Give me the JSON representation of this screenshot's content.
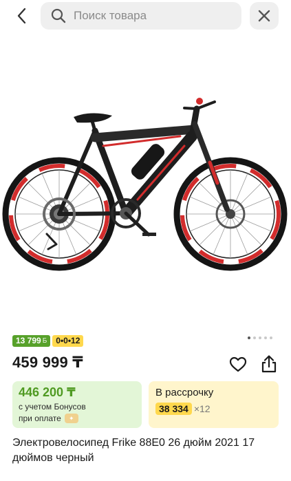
{
  "header": {
    "back_icon": "chevron-left-icon",
    "search_placeholder": "Поиск товара",
    "search_icon": "search-icon",
    "close_icon": "close-icon"
  },
  "product": {
    "image": "electric-bicycle-photo",
    "gallery": {
      "total": 5,
      "active_index": 0
    },
    "badges": {
      "bonus": "13 799",
      "bonus_suffix": "Б",
      "installment": "0•0•12"
    },
    "price": "459 999 ₸",
    "bonus_card": {
      "price": "446 200 ₸",
      "line1": "с учетом Бонусов",
      "line2": "при оплате"
    },
    "installment_card": {
      "title": "В рассрочку",
      "amount": "38 334",
      "months": "×12"
    },
    "title": "Электровелосипед Frike 88E0 26 дюйм 2021 17 дюймов черный"
  },
  "colors": {
    "bonus_green": "#57a12a",
    "installment_yellow": "#ffd84d",
    "bonus_card_bg": "#e3f6d7",
    "installment_card_bg": "#fff5cc"
  }
}
